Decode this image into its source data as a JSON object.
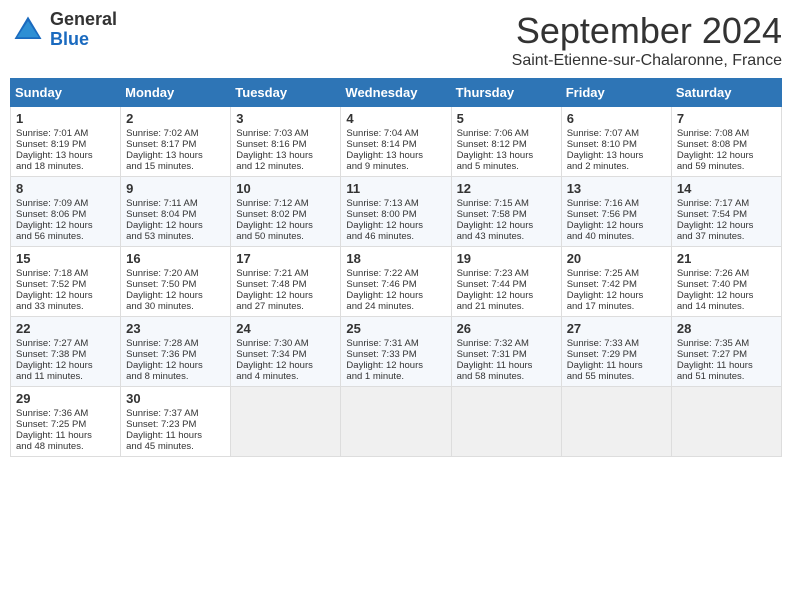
{
  "header": {
    "logo_line1": "General",
    "logo_line2": "Blue",
    "month_title": "September 2024",
    "location": "Saint-Etienne-sur-Chalaronne, France"
  },
  "days_of_week": [
    "Sunday",
    "Monday",
    "Tuesday",
    "Wednesday",
    "Thursday",
    "Friday",
    "Saturday"
  ],
  "weeks": [
    [
      {
        "day": "1",
        "lines": [
          "Sunrise: 7:01 AM",
          "Sunset: 8:19 PM",
          "Daylight: 13 hours",
          "and 18 minutes."
        ]
      },
      {
        "day": "2",
        "lines": [
          "Sunrise: 7:02 AM",
          "Sunset: 8:17 PM",
          "Daylight: 13 hours",
          "and 15 minutes."
        ]
      },
      {
        "day": "3",
        "lines": [
          "Sunrise: 7:03 AM",
          "Sunset: 8:16 PM",
          "Daylight: 13 hours",
          "and 12 minutes."
        ]
      },
      {
        "day": "4",
        "lines": [
          "Sunrise: 7:04 AM",
          "Sunset: 8:14 PM",
          "Daylight: 13 hours",
          "and 9 minutes."
        ]
      },
      {
        "day": "5",
        "lines": [
          "Sunrise: 7:06 AM",
          "Sunset: 8:12 PM",
          "Daylight: 13 hours",
          "and 5 minutes."
        ]
      },
      {
        "day": "6",
        "lines": [
          "Sunrise: 7:07 AM",
          "Sunset: 8:10 PM",
          "Daylight: 13 hours",
          "and 2 minutes."
        ]
      },
      {
        "day": "7",
        "lines": [
          "Sunrise: 7:08 AM",
          "Sunset: 8:08 PM",
          "Daylight: 12 hours",
          "and 59 minutes."
        ]
      }
    ],
    [
      {
        "day": "8",
        "lines": [
          "Sunrise: 7:09 AM",
          "Sunset: 8:06 PM",
          "Daylight: 12 hours",
          "and 56 minutes."
        ]
      },
      {
        "day": "9",
        "lines": [
          "Sunrise: 7:11 AM",
          "Sunset: 8:04 PM",
          "Daylight: 12 hours",
          "and 53 minutes."
        ]
      },
      {
        "day": "10",
        "lines": [
          "Sunrise: 7:12 AM",
          "Sunset: 8:02 PM",
          "Daylight: 12 hours",
          "and 50 minutes."
        ]
      },
      {
        "day": "11",
        "lines": [
          "Sunrise: 7:13 AM",
          "Sunset: 8:00 PM",
          "Daylight: 12 hours",
          "and 46 minutes."
        ]
      },
      {
        "day": "12",
        "lines": [
          "Sunrise: 7:15 AM",
          "Sunset: 7:58 PM",
          "Daylight: 12 hours",
          "and 43 minutes."
        ]
      },
      {
        "day": "13",
        "lines": [
          "Sunrise: 7:16 AM",
          "Sunset: 7:56 PM",
          "Daylight: 12 hours",
          "and 40 minutes."
        ]
      },
      {
        "day": "14",
        "lines": [
          "Sunrise: 7:17 AM",
          "Sunset: 7:54 PM",
          "Daylight: 12 hours",
          "and 37 minutes."
        ]
      }
    ],
    [
      {
        "day": "15",
        "lines": [
          "Sunrise: 7:18 AM",
          "Sunset: 7:52 PM",
          "Daylight: 12 hours",
          "and 33 minutes."
        ]
      },
      {
        "day": "16",
        "lines": [
          "Sunrise: 7:20 AM",
          "Sunset: 7:50 PM",
          "Daylight: 12 hours",
          "and 30 minutes."
        ]
      },
      {
        "day": "17",
        "lines": [
          "Sunrise: 7:21 AM",
          "Sunset: 7:48 PM",
          "Daylight: 12 hours",
          "and 27 minutes."
        ]
      },
      {
        "day": "18",
        "lines": [
          "Sunrise: 7:22 AM",
          "Sunset: 7:46 PM",
          "Daylight: 12 hours",
          "and 24 minutes."
        ]
      },
      {
        "day": "19",
        "lines": [
          "Sunrise: 7:23 AM",
          "Sunset: 7:44 PM",
          "Daylight: 12 hours",
          "and 21 minutes."
        ]
      },
      {
        "day": "20",
        "lines": [
          "Sunrise: 7:25 AM",
          "Sunset: 7:42 PM",
          "Daylight: 12 hours",
          "and 17 minutes."
        ]
      },
      {
        "day": "21",
        "lines": [
          "Sunrise: 7:26 AM",
          "Sunset: 7:40 PM",
          "Daylight: 12 hours",
          "and 14 minutes."
        ]
      }
    ],
    [
      {
        "day": "22",
        "lines": [
          "Sunrise: 7:27 AM",
          "Sunset: 7:38 PM",
          "Daylight: 12 hours",
          "and 11 minutes."
        ]
      },
      {
        "day": "23",
        "lines": [
          "Sunrise: 7:28 AM",
          "Sunset: 7:36 PM",
          "Daylight: 12 hours",
          "and 8 minutes."
        ]
      },
      {
        "day": "24",
        "lines": [
          "Sunrise: 7:30 AM",
          "Sunset: 7:34 PM",
          "Daylight: 12 hours",
          "and 4 minutes."
        ]
      },
      {
        "day": "25",
        "lines": [
          "Sunrise: 7:31 AM",
          "Sunset: 7:33 PM",
          "Daylight: 12 hours",
          "and 1 minute."
        ]
      },
      {
        "day": "26",
        "lines": [
          "Sunrise: 7:32 AM",
          "Sunset: 7:31 PM",
          "Daylight: 11 hours",
          "and 58 minutes."
        ]
      },
      {
        "day": "27",
        "lines": [
          "Sunrise: 7:33 AM",
          "Sunset: 7:29 PM",
          "Daylight: 11 hours",
          "and 55 minutes."
        ]
      },
      {
        "day": "28",
        "lines": [
          "Sunrise: 7:35 AM",
          "Sunset: 7:27 PM",
          "Daylight: 11 hours",
          "and 51 minutes."
        ]
      }
    ],
    [
      {
        "day": "29",
        "lines": [
          "Sunrise: 7:36 AM",
          "Sunset: 7:25 PM",
          "Daylight: 11 hours",
          "and 48 minutes."
        ]
      },
      {
        "day": "30",
        "lines": [
          "Sunrise: 7:37 AM",
          "Sunset: 7:23 PM",
          "Daylight: 11 hours",
          "and 45 minutes."
        ]
      },
      {
        "day": "",
        "lines": []
      },
      {
        "day": "",
        "lines": []
      },
      {
        "day": "",
        "lines": []
      },
      {
        "day": "",
        "lines": []
      },
      {
        "day": "",
        "lines": []
      }
    ]
  ]
}
